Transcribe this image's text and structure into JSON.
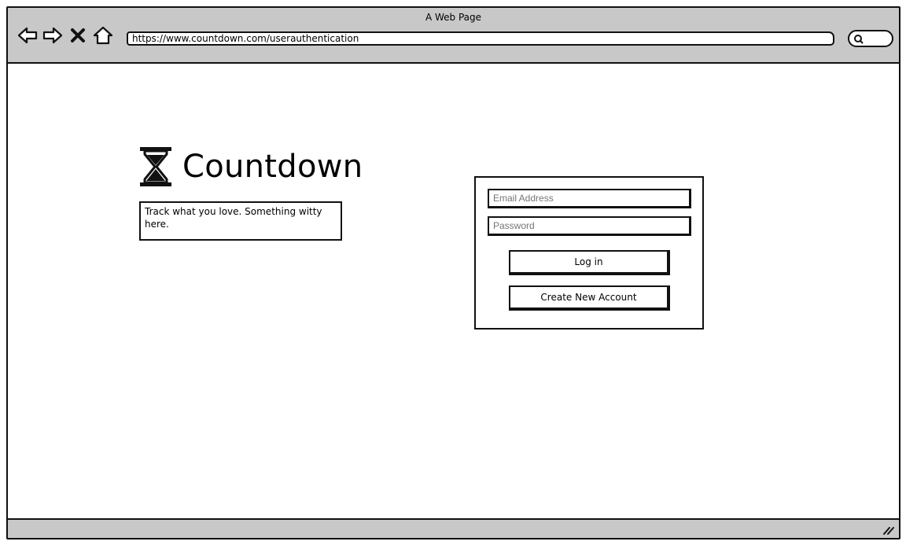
{
  "window": {
    "title": "A Web Page",
    "url": "https://www.countdown.com/userauthentication"
  },
  "nav": {
    "back_icon": "back-arrow-icon",
    "forward_icon": "forward-arrow-icon",
    "stop_icon": "close-icon",
    "home_icon": "home-icon",
    "search_icon": "search-icon"
  },
  "brand": {
    "name": "Countdown",
    "logo_icon": "hourglass-icon",
    "tagline": "Track what you love.  Something witty here."
  },
  "login": {
    "email_placeholder": "Email Address",
    "password_placeholder": "Password",
    "login_label": "Log in",
    "create_label": "Create New Account"
  },
  "colors": {
    "chrome": "#c8c8c8",
    "stroke": "#111111",
    "background": "#ffffff"
  }
}
